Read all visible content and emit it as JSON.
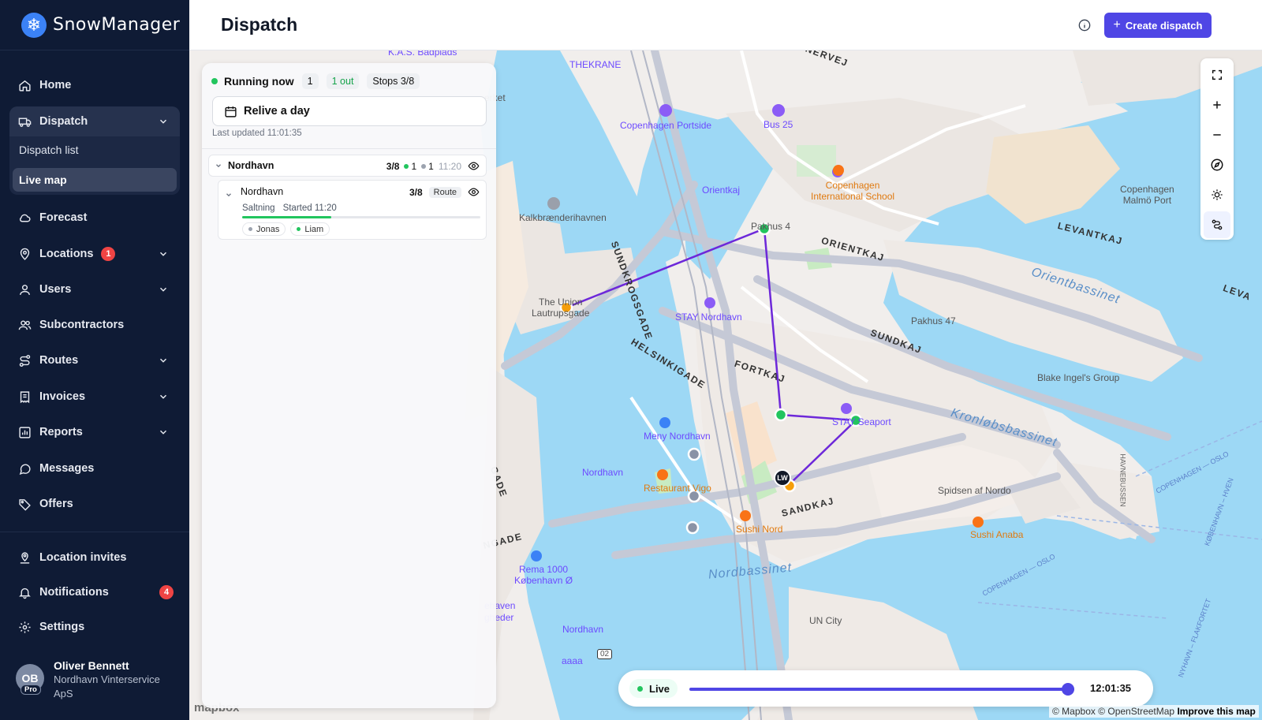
{
  "app": {
    "name": "SnowManager"
  },
  "sidebar": {
    "items": [
      {
        "label": "Home",
        "icon": "home-icon"
      },
      {
        "label": "Dispatch",
        "icon": "truck-icon"
      },
      {
        "label": "Forecast",
        "icon": "cloud-icon"
      },
      {
        "label": "Locations",
        "icon": "map-pin-icon",
        "badge": "1"
      },
      {
        "label": "Users",
        "icon": "user-icon"
      },
      {
        "label": "Subcontractors",
        "icon": "users-icon"
      },
      {
        "label": "Routes",
        "icon": "route-icon"
      },
      {
        "label": "Invoices",
        "icon": "receipt-icon"
      },
      {
        "label": "Reports",
        "icon": "chart-icon"
      },
      {
        "label": "Messages",
        "icon": "message-icon"
      },
      {
        "label": "Offers",
        "icon": "tag-icon"
      }
    ],
    "dispatch_sub": [
      "Dispatch list",
      "Live map"
    ],
    "bottom": [
      {
        "label": "Location invites",
        "icon": "pin-invite-icon"
      },
      {
        "label": "Notifications",
        "icon": "bell-icon",
        "badge": "4"
      },
      {
        "label": "Settings",
        "icon": "gear-icon"
      }
    ],
    "user": {
      "initials": "OB",
      "plan": "Pro",
      "name": "Oliver Bennett",
      "org": "Nordhavn Vinterservice ApS"
    }
  },
  "header": {
    "title": "Dispatch",
    "create_label": "Create dispatch"
  },
  "panel": {
    "running_label": "Running now",
    "running_count": "1",
    "out_label": "1 out",
    "stops_label": "Stops 3/8",
    "relive_label": "Relive a day",
    "updated": "Last updated 11:01:35",
    "group": {
      "name": "Nordhavn",
      "count": "3/8",
      "green": "1",
      "gray": "1",
      "time": "11:20"
    },
    "route": {
      "name": "Nordhavn",
      "count": "3/8",
      "tag": "Route",
      "service": "Saltning",
      "started": "Started 11:20",
      "progress": 0.375,
      "people": [
        {
          "name": "Jonas",
          "status": "#9ca3af"
        },
        {
          "name": "Liam",
          "status": "#22c55e"
        }
      ]
    }
  },
  "timeline": {
    "live_label": "Live",
    "time": "12:01:35",
    "position": 1.0
  },
  "map": {
    "attribution": "© Mapbox © OpenStreetMap",
    "improve": "Improve this map",
    "logo": "mapbox",
    "vehicle": "LW",
    "labels": {
      "kas": "K.A.S. Badplads",
      "thekrane": "THEKRANE",
      "portside": "Copenhagen Portside",
      "bus25": "Bus 25",
      "orientkaj_stop": "Orientkaj",
      "cis1": "Copenhagen",
      "cis2": "International School",
      "cmp1": "Copenhagen",
      "cmp2": "Malmö Port",
      "kalk": "Kalkbrænderihavnen",
      "pakhus": "Pakhus 4",
      "union1": "The Union",
      "union2": "Lautrupsgade",
      "stay": "STAY Nordhavn",
      "pakhus47": "Pakhus 47",
      "blake": "Blake Ingel's Group",
      "stayport": "STAY Seaport",
      "meny": "Meny Nordhavn",
      "nordhavn_st": "Nordhavn",
      "rest": "Restaurant Vigo",
      "sushinord": "Sushi Nord",
      "spidsen": "Spidsen af Nordo",
      "sushianaba": "Sushi Anaba",
      "rema1": "Rema 1000",
      "rema2": "København Ø",
      "nordhavn2": "Nordhavn",
      "aaaa": "aaaa",
      "ucity": "UN City",
      "road02": "02",
      "merket": "erket",
      "hav1": "ehaven",
      "hav2": "gheder"
    },
    "roads": {
      "sundkrog": "SUNDKROGSGADE",
      "orientkaj": "ORIENTKAJ",
      "levantkaj": "LEVANTKAJ",
      "sundkaj": "SUNDKAJ",
      "helsinki": "HELSINKIGADE",
      "fortkaj": "FORTKAJ",
      "sandkaj": "SANDKAJ",
      "gade": "GADE",
      "ngade": "NGADE",
      "havne": "HAVNEBUSSEN",
      "cph_oslo": "COPENHAGEN — OSLO",
      "kbh_oslo": "KØBENHAVN – HVEN",
      "nyhavn": "NYHAVN – FLAKFORTET",
      "cph_oslo2": "COPENHAGEN — OSLO",
      "cph_oslo3": "COPENHAGEN — OSLO",
      "nerve": "NERVEJ",
      "leva": "LEVA"
    },
    "water": {
      "orient": "Orientbassinet",
      "kronlob": "Kronløbsbassinet",
      "nordb": "Nordbassinet"
    }
  },
  "colors": {
    "accent": "#4f46e5",
    "route": "#6d28d9",
    "done": "#22c55e",
    "pending": "#f59e0b",
    "idle": "#8a93a6",
    "sidebar": "#0f1b35"
  }
}
